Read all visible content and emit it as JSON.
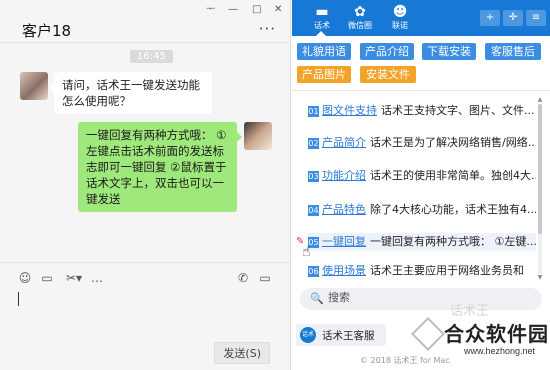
{
  "chat": {
    "title": "客户18",
    "window_controls": {
      "pin": "ᅮ",
      "minimize": "—",
      "maximize": "□",
      "close": "✕"
    },
    "more": "···",
    "timestamp": "16:45",
    "messages": [
      {
        "from": "guest",
        "text": "请问，话术王一键发送功能怎么使用呢？"
      },
      {
        "from": "agent",
        "text": "一键回复有两种方式哦： ①左键点击话术前面的发送标志即可一键回复 ②鼠标置于话术文字上，双击也可以一键发送"
      }
    ],
    "toolbar": {
      "emoji": "☺",
      "folder": "▭",
      "scissors": "✂▾",
      "bubble": "…",
      "phone": "✆",
      "video": "▭"
    },
    "send_label": "发送(S)"
  },
  "panel": {
    "nav": [
      {
        "icon": "chat-icon",
        "glyph": "▬",
        "label": "话术"
      },
      {
        "icon": "flower-icon",
        "glyph": "✿",
        "label": "微信圈"
      },
      {
        "icon": "user-icon",
        "glyph": "☻",
        "label": "联诺"
      }
    ],
    "header_buttons": {
      "add_user": "+",
      "move": "✛",
      "menu": "≡"
    },
    "categories": [
      {
        "label": "礼貌用语",
        "color": "#3a8de0"
      },
      {
        "label": "产品介绍",
        "color": "#3a8de0"
      },
      {
        "label": "下载安装",
        "color": "#3a8de0"
      },
      {
        "label": "客服售后",
        "color": "#3a8de0"
      },
      {
        "label": "产品图片",
        "color": "#f3a329"
      },
      {
        "label": "安装文件",
        "color": "#f3a329"
      }
    ],
    "items": [
      {
        "num": "01",
        "title": "图文件支持",
        "text": "话术王支持文字、图片、文件..."
      },
      {
        "num": "02",
        "title": "产品简介",
        "text": "话术王是为了解决网络销售/网络..."
      },
      {
        "num": "03",
        "title": "功能介绍",
        "text": "话术王的使用非常简单。独创4大..."
      },
      {
        "num": "04",
        "title": "产品特色",
        "text": "除了4大核心功能，话术王独有4..."
      },
      {
        "num": "05",
        "title": "一键回复",
        "text": "一键回复有两种方式哦： ①左键..."
      },
      {
        "num": "06",
        "title": "使用场景",
        "text": "话术王主要应用于网络业务员和"
      }
    ],
    "scroll_up": "▲",
    "scroll_down": "▼",
    "edit_icon": "✎",
    "cursor_icon": "☝",
    "search_icon": "🔍",
    "search_placeholder": "搜索",
    "service_logo": "话术王",
    "service_label": "话术王客服",
    "footer": "© 2018 话术王 for Mac"
  },
  "watermark": {
    "faint": "话术王",
    "brand": "合众软件园",
    "url": "www.hezhong.net"
  }
}
